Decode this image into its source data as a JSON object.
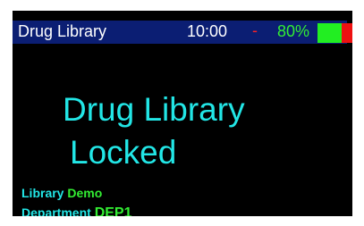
{
  "status_bar": {
    "title": "Drug Library",
    "time": "10:00",
    "separator": "-",
    "battery_percent": "80%",
    "battery_level": 0.8
  },
  "message": {
    "line1": "Drug Library",
    "line2": "Locked"
  },
  "info": {
    "library_label": "Library",
    "library_value": "Demo",
    "department_label": "Department",
    "department_value": "DEP1"
  },
  "colors": {
    "status_bar_bg": "#0b1e73",
    "message_text": "#22e6e6",
    "value_text": "#33ee33",
    "separator": "#ff2222",
    "battery_charged": "#22ee22",
    "battery_empty": "#ee1111"
  }
}
